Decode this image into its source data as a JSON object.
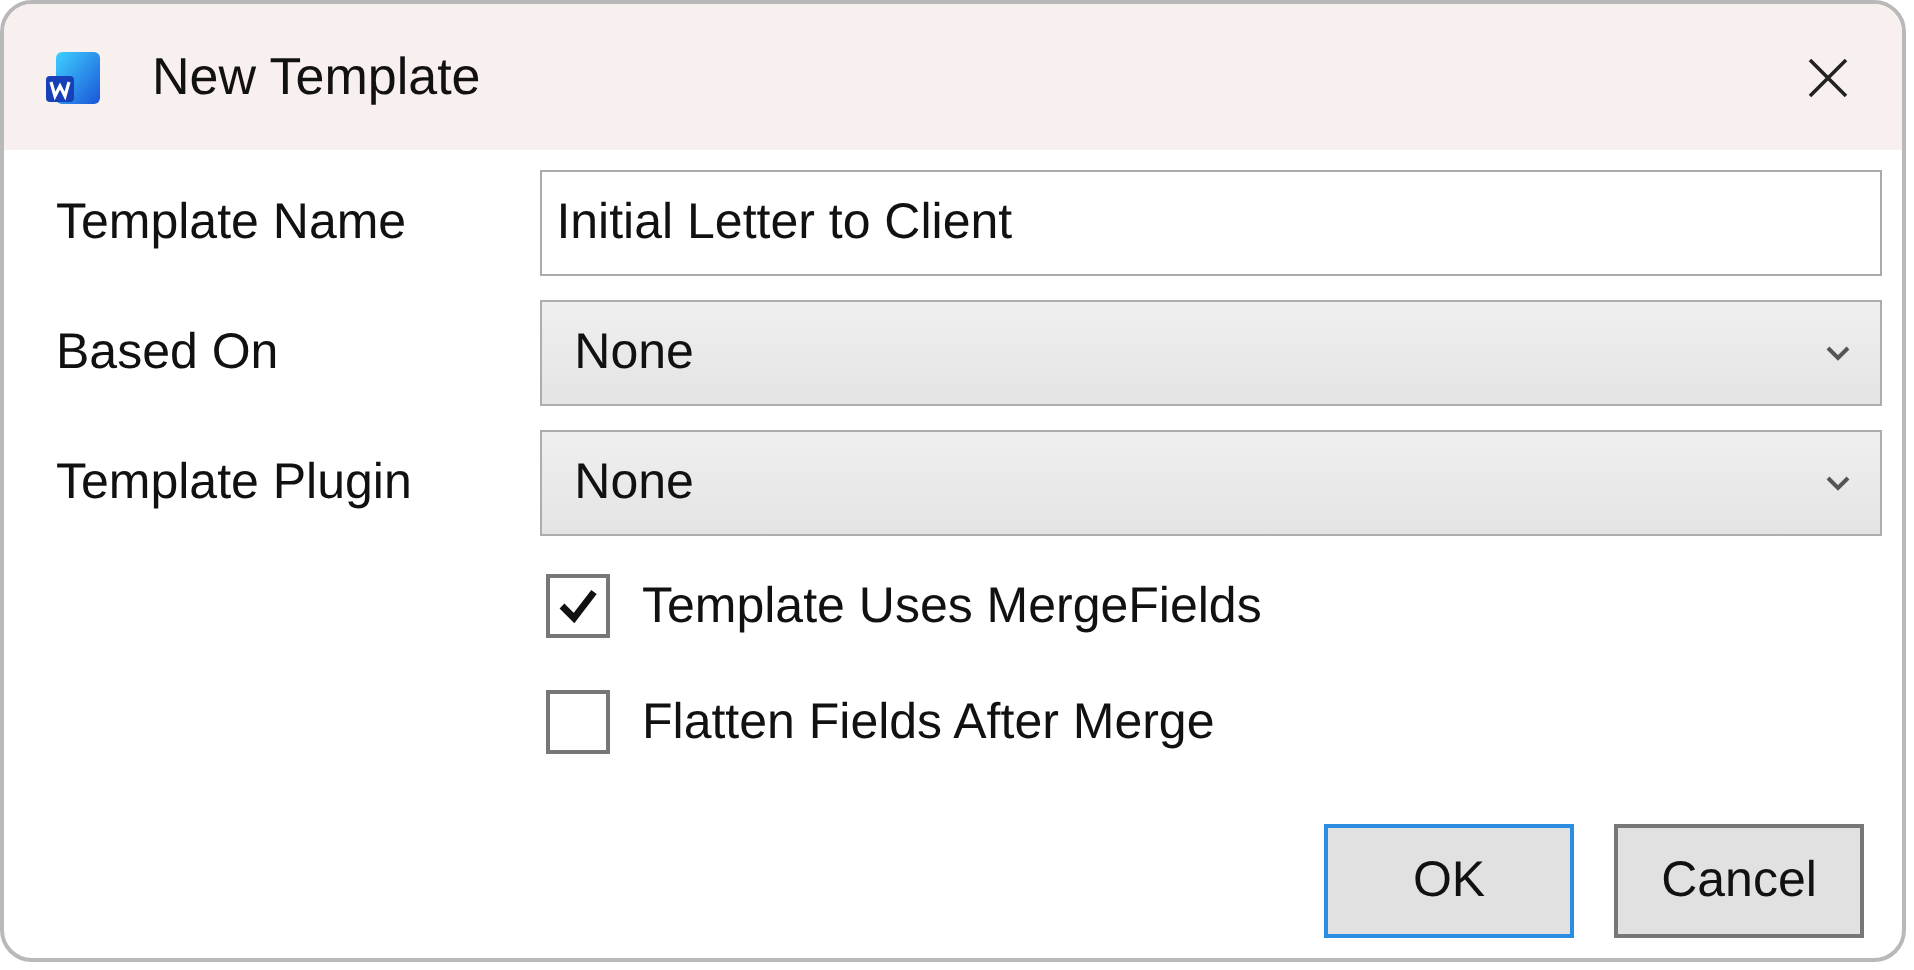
{
  "window": {
    "title": "New Template"
  },
  "fields": [
    {
      "label": "Template Name",
      "kind": "text",
      "value": "Initial Letter to Client"
    },
    {
      "label": "Based On",
      "kind": "dropdown",
      "value": "None"
    },
    {
      "label": "Template Plugin",
      "kind": "dropdown",
      "value": "None"
    }
  ],
  "checkboxes": [
    {
      "label": "Template Uses MergeFields",
      "checked": true
    },
    {
      "label": "Flatten Fields After Merge",
      "checked": false
    }
  ],
  "buttons": [
    {
      "label": "OK",
      "default": true
    },
    {
      "label": "Cancel",
      "default": false
    }
  ]
}
